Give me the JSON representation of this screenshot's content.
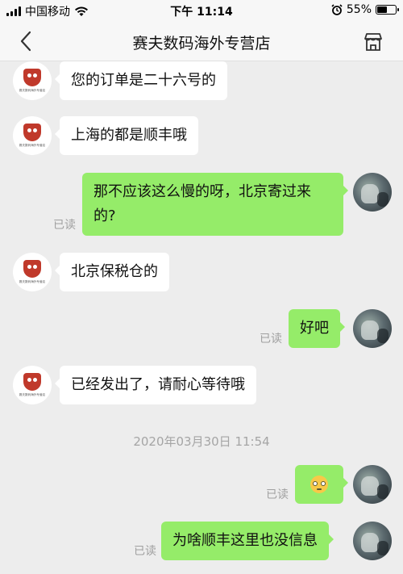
{
  "status_bar": {
    "carrier": "中国移动",
    "time": "下午 11:14",
    "battery_percent_label": "55%",
    "battery_level": 0.55
  },
  "nav": {
    "title": "赛夫数码海外专营店"
  },
  "shop_avatar_caption": "赛夫数码海外专营店",
  "messages": [
    {
      "side": "in",
      "text": "您的订单是二十六号的"
    },
    {
      "side": "in",
      "text": "上海的都是顺丰哦"
    },
    {
      "side": "out",
      "text_line1": "那不应该这么慢的呀，北京寄过来",
      "text_line2": "的?",
      "read": "已读"
    },
    {
      "side": "in",
      "text": "北京保税仓的"
    },
    {
      "side": "out",
      "text": "好吧",
      "read": "已读"
    },
    {
      "side": "in",
      "text": "已经发出了，请耐心等待哦"
    },
    {
      "side": "out",
      "emoji": "pleading-face-emoji",
      "read": "已读"
    },
    {
      "side": "out",
      "text": "为啥顺丰这里也没信息",
      "read": "已读"
    }
  ],
  "timestamp": "2020年03月30日 11:54",
  "colors": {
    "background": "#ededed",
    "outgoing_bubble": "#95ec69",
    "incoming_bubble": "#ffffff",
    "read_label": "#a0a0a0"
  }
}
